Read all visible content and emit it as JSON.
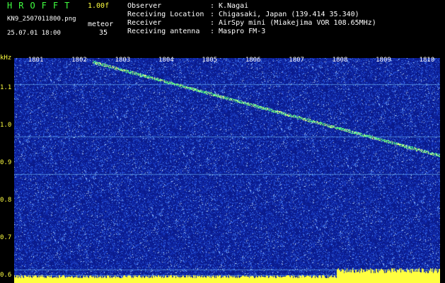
{
  "header": {
    "app_title": "HROFFT",
    "version": "1.00f",
    "filename": "KN9_2507011800.png",
    "meteor_label": "meteor",
    "datetime": "25.07.01 18:00",
    "meteor_count": "35"
  },
  "info": [
    {
      "label": "Observer",
      "sep": ":",
      "value": "K.Nagai"
    },
    {
      "label": "Receiving Location",
      "sep": ":",
      "value": "Chigasaki, Japan (139.414 35.340)"
    },
    {
      "label": "Receiver",
      "sep": ":",
      "value": "AirSpy mini (Miakejima VOR 108.65MHz)"
    },
    {
      "label": "Receiving antenna",
      "sep": ":",
      "value": "Maspro FM-3"
    }
  ],
  "chart_data": {
    "type": "heatmap",
    "ylabel": "kHz",
    "y_ticks": [
      "1.1",
      "1.0",
      "0.9",
      "0.8",
      "0.7",
      "0.6"
    ],
    "x_ticks": [
      "1801",
      "1802",
      "1803",
      "1804",
      "1805",
      "1806",
      "1807",
      "1808",
      "1809",
      "1810"
    ],
    "ylim": [
      0.58,
      1.18
    ],
    "xlim": [
      1800.5,
      1810.3
    ],
    "meteor_trace": {
      "x": [
        1802.3,
        1810.3
      ],
      "y": [
        1.17,
        0.92
      ]
    },
    "colors": {
      "background": "#0a1a8a",
      "noise": "#5080ff",
      "signal": "#40ff80",
      "baseline": "#ffff40"
    }
  }
}
